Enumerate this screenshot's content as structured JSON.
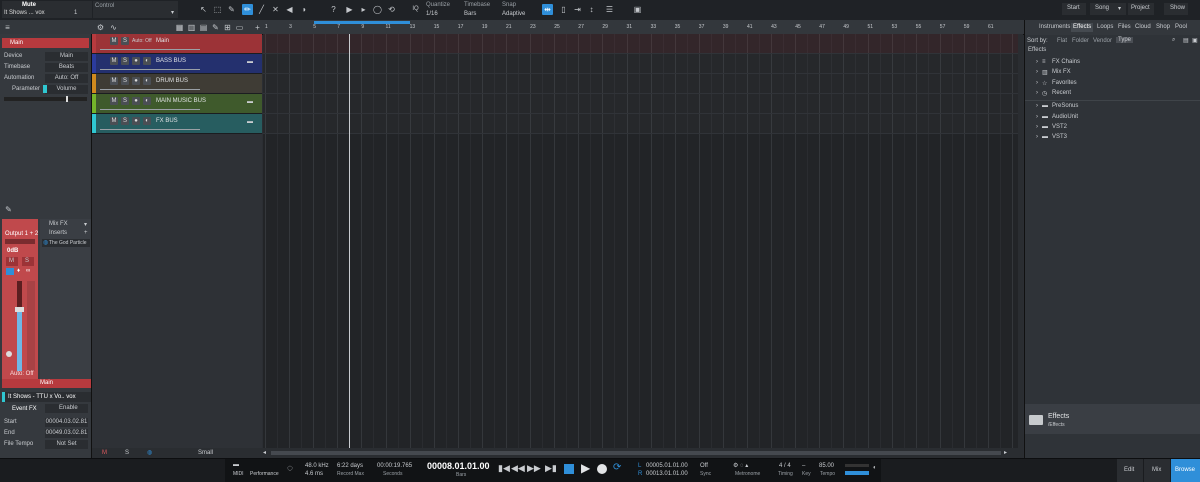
{
  "toolbar": {
    "track_title": "Mute",
    "song_name": "It Shows ... vox",
    "song_num": "1",
    "control_label": "Control",
    "quantize_label": "Quantize",
    "quantize_value": "1/16",
    "timebase_label": "Timebase",
    "timebase_value": "Bars",
    "snap_label": "Snap",
    "snap_value": "Adaptive",
    "iq": "IQ",
    "right": [
      "Start",
      "Song",
      "Project",
      "Show"
    ]
  },
  "ruler": [
    "1",
    "3",
    "5",
    "7",
    "9",
    "11",
    "13",
    "15",
    "17",
    "19",
    "21",
    "23",
    "25",
    "27",
    "29",
    "31",
    "33",
    "35",
    "37",
    "39",
    "41",
    "43",
    "45",
    "47",
    "49",
    "51",
    "53",
    "55",
    "57",
    "59",
    "61"
  ],
  "inspector": {
    "top": "Main",
    "rows": [
      {
        "k": "Device",
        "v": "Main"
      },
      {
        "k": "Timebase",
        "v": "Beats"
      },
      {
        "k": "Automation",
        "v": "Auto: Off"
      },
      {
        "k": "Parameter",
        "v": "Volume"
      }
    ],
    "mixfx": "Mix FX",
    "output": "Output 1 + 2",
    "db": "0dB",
    "inserts": "Inserts",
    "plugin": "The God Particle",
    "m": "M",
    "s": "S",
    "auto_off": "Auto: Off",
    "channel_name": "Main",
    "event_name": "It Shows - TTU x Vo.. vox",
    "event_fx": "Event FX",
    "enable": "Enable",
    "event_rows": [
      {
        "k": "Start",
        "v": "00004.03.02.81"
      },
      {
        "k": "End",
        "v": "00049.03.02.81"
      },
      {
        "k": "File Tempo",
        "v": "Not Set"
      }
    ]
  },
  "tracks": [
    {
      "name": "Main",
      "auto": "Auto: Off",
      "color": "#b73a3e",
      "bg": "#9c3337"
    },
    {
      "name": "BASS BUS",
      "color": "#2b3b9d",
      "bg": "#24306e"
    },
    {
      "name": "DRUM BUS",
      "color": "#d08a1e",
      "bg": "#3f3c35"
    },
    {
      "name": "MAIN MUSIC BUS",
      "color": "#74b52a",
      "bg": "#3f5a2c"
    },
    {
      "name": "FX BUS",
      "color": "#2fc7d1",
      "bg": "#275d60"
    }
  ],
  "browser": {
    "tabs": [
      "Instruments",
      "Effects",
      "Loops",
      "Files",
      "Cloud",
      "Shop",
      "Pool"
    ],
    "sort_label": "Sort by:",
    "sorts": [
      "Flat",
      "Folder",
      "Vendor",
      "Type"
    ],
    "heading": "Effects",
    "items": [
      "FX Chains",
      "Mix FX",
      "Favorites",
      "Recent",
      "PreSonus",
      "AudioUnit",
      "VST2",
      "VST3"
    ],
    "footer_title": "Effects",
    "footer_path": "/Effects"
  },
  "bottom_left": {
    "m": "M",
    "s": "S",
    "small": "Small"
  },
  "transport": {
    "midi": "MIDI",
    "performance": "Performance",
    "rate": "48.0 kHz",
    "latency": "4.6 ms",
    "days": "6:22 days",
    "record_max": "Record Max",
    "seconds_val": "00:00:19.765",
    "seconds": "Seconds",
    "position": "00008.01.01.00",
    "bars": "Bars",
    "l_label": "L",
    "l_val": "00005.01.01.00",
    "r_label": "R",
    "r_val": "00013.01.01.00",
    "sync_val": "Off",
    "sync": "Sync",
    "metronome": "Metronome",
    "timing_val": "4 / 4",
    "timing": "Timing",
    "key": "Key",
    "tempo_val": "85.00",
    "tempo": "Tempo",
    "edit": "Edit",
    "mix": "Mix",
    "browse": "Browse"
  },
  "colors": {
    "accent": "#2f8fd9"
  }
}
